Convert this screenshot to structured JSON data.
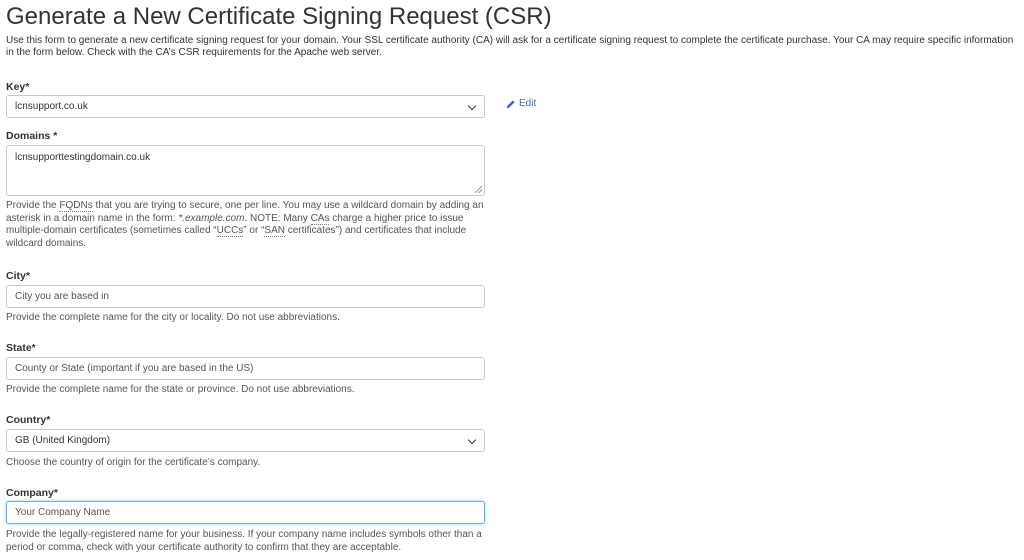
{
  "page": {
    "title": "Generate a New Certificate Signing Request (CSR)",
    "intro": "Use this form to generate a new certificate signing request for your domain. Your SSL certificate authority (CA) will ask for a certificate signing request to complete the certificate purchase. Your CA may require specific information in the form below. Check with the CA’s CSR requirements for the Apache web server."
  },
  "key": {
    "label": "Key*",
    "value": "lcnsupport.co.uk",
    "edit_label": "Edit",
    "edit_icon": "pencil-icon"
  },
  "domains": {
    "label": "Domains *",
    "value": "lcnsupporttestingdomain.co.uk",
    "help": {
      "p1": "Provide the ",
      "fqdn": "FQDNs",
      "p2": " that you are trying to secure, one per line. You may use a wildcard domain by adding an asterisk in a domain name in the form: ",
      "example": "*.example.com",
      "p3": ". NOTE: Many ",
      "cas": "CAs",
      "p4": " charge a higher price to issue multiple-domain certificates (sometimes called “",
      "uccs": "UCCs",
      "p5": "” or “",
      "san": "SAN",
      "p6": " certificates”) and certificates that include wildcard domains."
    }
  },
  "city": {
    "label": "City*",
    "placeholder": "City you are based in",
    "help": "Provide the complete name for the city or locality. Do not use abbreviations."
  },
  "state": {
    "label": "State*",
    "placeholder": "County or State (important if you are based in the US)",
    "help": "Provide the complete name for the state or province. Do not use abbreviations."
  },
  "country": {
    "label": "Country*",
    "value": "GB (United Kingdom)",
    "help": "Choose the country of origin for the certificate’s company."
  },
  "company": {
    "label": "Company*",
    "placeholder": "Your Company Name",
    "help": "Provide the legally-registered name for your business. If your company name includes symbols other than a period or comma, check with your certificate authority to confirm that they are acceptable."
  },
  "colors": {
    "link": "#3a6fb0",
    "focus_border": "#66afe9",
    "text": "#333333",
    "help_text": "#555555"
  }
}
